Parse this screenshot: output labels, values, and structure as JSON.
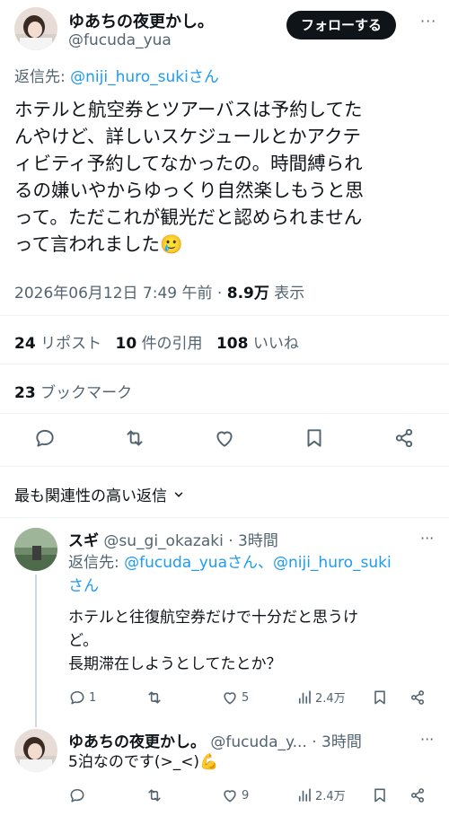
{
  "tweet": {
    "author_name": "ゆあちの夜更かし。",
    "author_handle": "@fucuda_yua",
    "follow_label": "フォローする",
    "more_label": "···",
    "reply_to_prefix": "返信先: ",
    "reply_to_link": "@niji_huro_sukiさん",
    "text_lines": [
      "ホテルと航空券とツアーバスは予約してた",
      "んやけど、詳しいスケジュールとかアクテ",
      "ィビティ予約してなかったの。時間縛られ",
      "るの嫌いやからゆっくり自然楽しもうと思",
      "って。ただこれが観光だと認められません",
      "って言われました🥲"
    ],
    "timestamp": "2026年06月12日 7:49 午前",
    "dot": "·",
    "views_value": "8.9万",
    "views_label": "表示",
    "reposts_value": "24",
    "reposts_label": "リポスト",
    "quotes_value": "10",
    "quotes_label": "件の引用",
    "likes_value": "108",
    "likes_label": "いいね",
    "bookmarks_value": "23",
    "bookmarks_label": "ブックマーク"
  },
  "sort": {
    "label": "最も関連性の高い返信"
  },
  "replies": [
    {
      "name": "スギ",
      "handle": "@su_gi_okazaki",
      "time": "· 3時間",
      "more": "···",
      "reply_to_prefix": "返信先: ",
      "reply_to_link1": "@fucuda_yuaさん、@niji_huro_suki",
      "reply_to_link2": "さん",
      "text_lines": [
        "ホテルと往復航空券だけで十分だと思うけ",
        "ど。",
        "長期滞在しようとしてたとか？"
      ],
      "reply_count": "1",
      "retweet_count": "",
      "like_count": "5",
      "views_count": "2.4万"
    },
    {
      "name": "ゆあちの夜更かし。",
      "handle": "@fucuda_y...",
      "time": "· 3時間",
      "more": "···",
      "text_lines": [
        "5泊なのです(>_<)💪"
      ],
      "reply_count": "",
      "retweet_count": "",
      "like_count": "9",
      "views_count": "2.4万"
    }
  ],
  "icons": {
    "reply": "reply-icon",
    "retweet": "retweet-icon",
    "like": "heart-icon",
    "bookmark": "bookmark-icon",
    "share": "share-icon",
    "views": "views-icon",
    "chevron": "chevron-down-icon"
  },
  "colors": {
    "link": "#1d9bf0",
    "text": "#0f1419",
    "secondary": "#536471",
    "divider": "#eff3f4",
    "button_bg": "#0f1419"
  }
}
